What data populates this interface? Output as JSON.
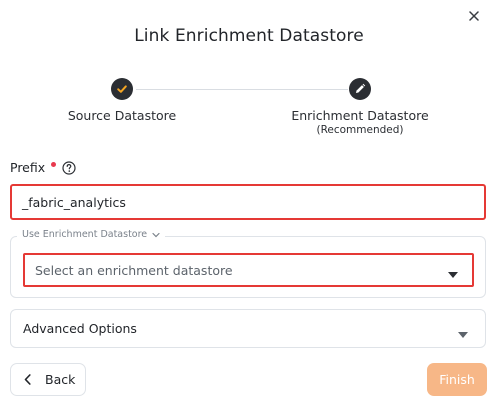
{
  "dialog": {
    "title": "Link Enrichment Datastore",
    "close_icon": "close-icon"
  },
  "stepper": {
    "steps": [
      {
        "label": "Source Datastore",
        "status": "completed",
        "icon": "check-icon",
        "icon_color": "#f5a623"
      },
      {
        "label": "Enrichment Datastore",
        "sublabel": "(Recommended)",
        "status": "active",
        "icon": "pencil-icon"
      }
    ]
  },
  "prefix": {
    "label": "Prefix",
    "required": true,
    "help_icon": "help-circle-icon",
    "value": "_fabric_analytics"
  },
  "enrichment": {
    "legend": "Use Enrichment Datastore",
    "select_placeholder": "Select an enrichment datastore"
  },
  "advanced": {
    "label": "Advanced Options"
  },
  "footer": {
    "back_label": "Back",
    "finish_label": "Finish"
  },
  "colors": {
    "accent": "#f5a623",
    "finish_bg": "#f7b787",
    "highlight": "#e53935",
    "required_dot": "#e8394e"
  }
}
